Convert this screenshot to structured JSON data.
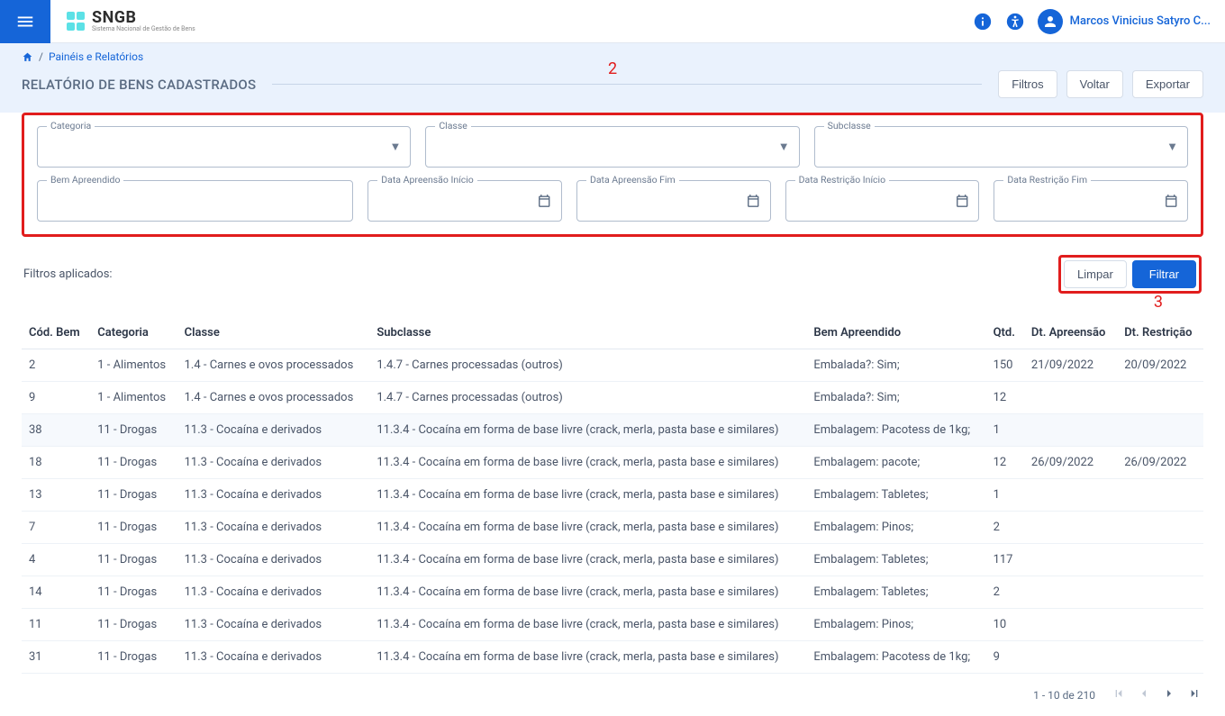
{
  "header": {
    "app_name": "SNGB",
    "app_tagline": "Sistema Nacional de Gestão de Bens",
    "user_name": "Marcos Vinicius Satyro C..."
  },
  "breadcrumb": {
    "sep": "/",
    "item1": "Painéis e Relatórios"
  },
  "page": {
    "title": "RELATÓRIO DE BENS CADASTRADOS",
    "filtros_btn": "Filtros",
    "voltar_btn": "Voltar",
    "exportar_btn": "Exportar"
  },
  "callouts": {
    "n2": "2",
    "n3": "3"
  },
  "filters": {
    "categoria_label": "Categoria",
    "classe_label": "Classe",
    "subclasse_label": "Subclasse",
    "bem_apreendido_label": "Bem Apreendido",
    "data_apreensao_inicio_label": "Data Apreensão Início",
    "data_apreensao_fim_label": "Data Apreensão Fim",
    "data_restricao_inicio_label": "Data Restrição Início",
    "data_restricao_fim_label": "Data Restrição Fim",
    "applied_label": "Filtros aplicados:",
    "limpar_btn": "Limpar",
    "filtrar_btn": "Filtrar"
  },
  "table": {
    "headers": {
      "cod_bem": "Cód. Bem",
      "categoria": "Categoria",
      "classe": "Classe",
      "subclasse": "Subclasse",
      "bem_apreendido": "Bem Apreendido",
      "qtd": "Qtd.",
      "dt_apreensao": "Dt. Apreensão",
      "dt_restricao": "Dt. Restrição"
    },
    "rows": [
      {
        "cod": "2",
        "cat": "1 - Alimentos",
        "cla": "1.4 - Carnes e ovos processados",
        "sub": "1.4.7 - Carnes processadas (outros)",
        "bem": "Embalada?: Sim;",
        "qtd": "150",
        "da": "21/09/2022",
        "dr": "20/09/2022"
      },
      {
        "cod": "9",
        "cat": "1 - Alimentos",
        "cla": "1.4 - Carnes e ovos processados",
        "sub": "1.4.7 - Carnes processadas (outros)",
        "bem": "Embalada?: Sim;",
        "qtd": "12",
        "da": "",
        "dr": ""
      },
      {
        "cod": "38",
        "cat": "11 - Drogas",
        "cla": "11.3 - Cocaína e derivados",
        "sub": "11.3.4 - Cocaína em forma de base livre (crack, merla, pasta base e similares)",
        "bem": "Embalagem: Pacotess de 1kg;",
        "qtd": "1",
        "da": "",
        "dr": "",
        "hover": true
      },
      {
        "cod": "18",
        "cat": "11 - Drogas",
        "cla": "11.3 - Cocaína e derivados",
        "sub": "11.3.4 - Cocaína em forma de base livre (crack, merla, pasta base e similares)",
        "bem": "Embalagem: pacote;",
        "qtd": "12",
        "da": "26/09/2022",
        "dr": "26/09/2022"
      },
      {
        "cod": "13",
        "cat": "11 - Drogas",
        "cla": "11.3 - Cocaína e derivados",
        "sub": "11.3.4 - Cocaína em forma de base livre (crack, merla, pasta base e similares)",
        "bem": "Embalagem: Tabletes;",
        "qtd": "1",
        "da": "",
        "dr": ""
      },
      {
        "cod": "7",
        "cat": "11 - Drogas",
        "cla": "11.3 - Cocaína e derivados",
        "sub": "11.3.4 - Cocaína em forma de base livre (crack, merla, pasta base e similares)",
        "bem": "Embalagem: Pinos;",
        "qtd": "2",
        "da": "",
        "dr": ""
      },
      {
        "cod": "4",
        "cat": "11 - Drogas",
        "cla": "11.3 - Cocaína e derivados",
        "sub": "11.3.4 - Cocaína em forma de base livre (crack, merla, pasta base e similares)",
        "bem": "Embalagem: Tabletes;",
        "qtd": "117",
        "da": "",
        "dr": ""
      },
      {
        "cod": "14",
        "cat": "11 - Drogas",
        "cla": "11.3 - Cocaína e derivados",
        "sub": "11.3.4 - Cocaína em forma de base livre (crack, merla, pasta base e similares)",
        "bem": "Embalagem: Tabletes;",
        "qtd": "2",
        "da": "",
        "dr": ""
      },
      {
        "cod": "11",
        "cat": "11 - Drogas",
        "cla": "11.3 - Cocaína e derivados",
        "sub": "11.3.4 - Cocaína em forma de base livre (crack, merla, pasta base e similares)",
        "bem": "Embalagem: Pinos;",
        "qtd": "10",
        "da": "",
        "dr": ""
      },
      {
        "cod": "31",
        "cat": "11 - Drogas",
        "cla": "11.3 - Cocaína e derivados",
        "sub": "11.3.4 - Cocaína em forma de base livre (crack, merla, pasta base e similares)",
        "bem": "Embalagem: Pacotess de 1kg;",
        "qtd": "9",
        "da": "",
        "dr": ""
      }
    ]
  },
  "pager": {
    "range": "1 - 10 de 210"
  }
}
